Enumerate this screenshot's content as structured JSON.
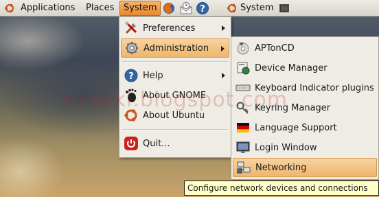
{
  "panel": {
    "applications": "Applications",
    "places": "Places",
    "system": "System",
    "system_right": "System"
  },
  "main_menu": {
    "items": [
      {
        "label": "Preferences",
        "icon": "preferences-icon",
        "submenu": true
      },
      {
        "label": "Administration",
        "icon": "administration-icon",
        "submenu": true,
        "active": true
      },
      {
        "label": "Help",
        "icon": "help-icon",
        "submenu": true
      },
      {
        "label": "About GNOME",
        "icon": "gnome-foot-icon"
      },
      {
        "label": "About Ubuntu",
        "icon": "ubuntu-logo-icon"
      },
      {
        "label": "Quit...",
        "icon": "power-icon"
      }
    ]
  },
  "admin_menu": {
    "items": [
      {
        "label": "APTonCD",
        "icon": "cd-icon"
      },
      {
        "label": "Device Manager",
        "icon": "device-manager-icon"
      },
      {
        "label": "Keyboard Indicator plugins",
        "icon": "keyboard-icon"
      },
      {
        "label": "Keyring Manager",
        "icon": "keyring-icon"
      },
      {
        "label": "Language Support",
        "icon": "flag-icon"
      },
      {
        "label": "Login Window",
        "icon": "monitor-icon"
      },
      {
        "label": "Networking",
        "icon": "network-icon",
        "active": true
      }
    ]
  },
  "tooltip": "Configure network devices and connections",
  "watermark": "nxwiki.blogspot.com",
  "colors": {
    "highlight": "#eeb66c",
    "menu_bg": "#efece6",
    "panel_bg": "#d9d5cc"
  }
}
